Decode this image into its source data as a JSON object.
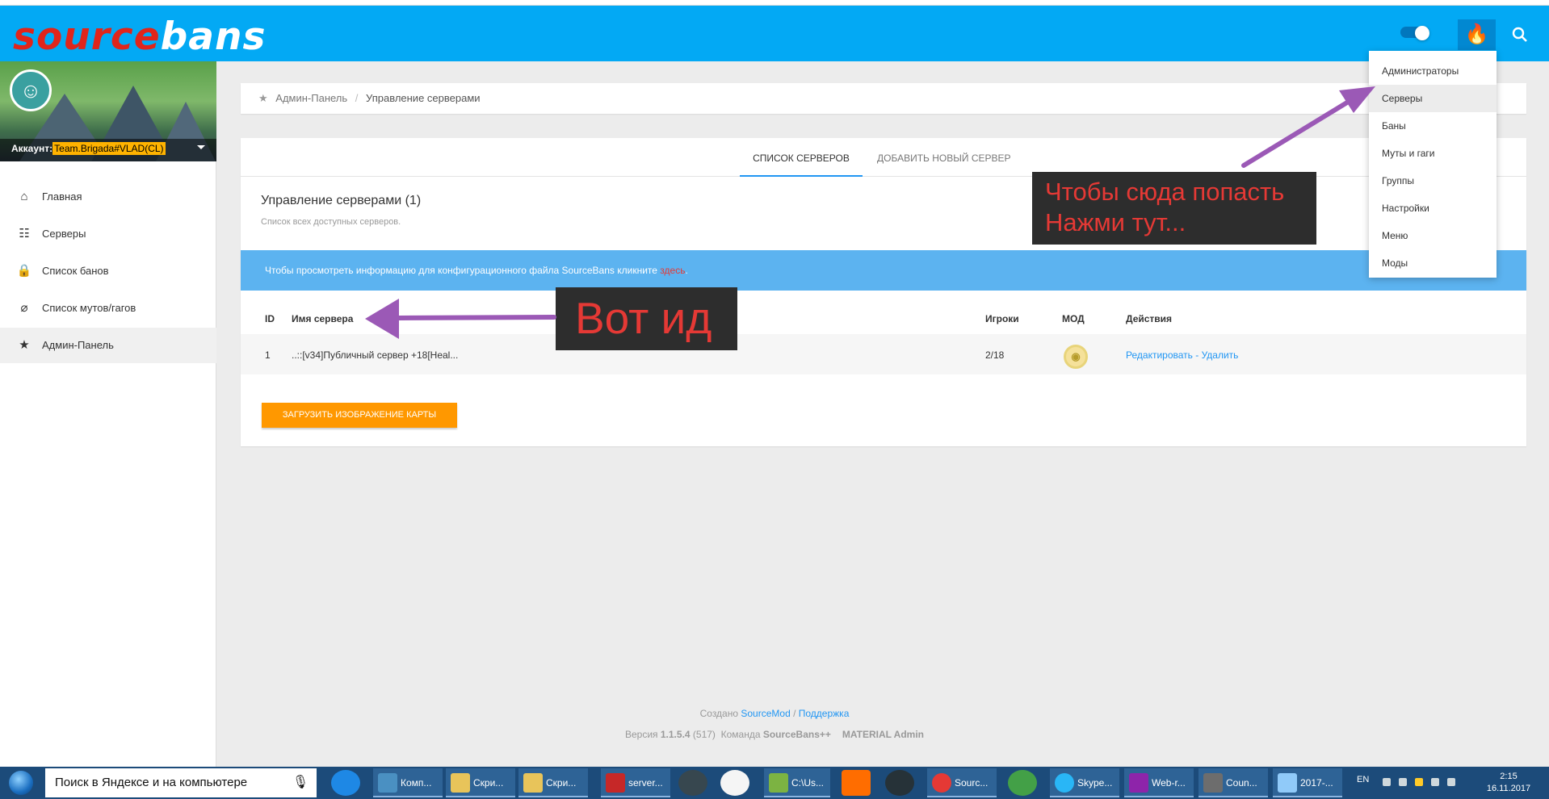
{
  "header": {
    "logo_part1": "source",
    "logo_part2": "bans",
    "search_icon": "search-icon",
    "fire_icon": "fire-icon"
  },
  "sidebar": {
    "account_label": "Аккаунт:",
    "account_name": "Team.Brigada#VLAD(CL)",
    "items": [
      {
        "label": "Главная",
        "icon": "home-icon"
      },
      {
        "label": "Серверы",
        "icon": "sliders-icon"
      },
      {
        "label": "Список банов",
        "icon": "lock-icon"
      },
      {
        "label": "Список мутов/гагов",
        "icon": "mic-off-icon"
      },
      {
        "label": "Админ-Панель",
        "icon": "star-icon"
      }
    ]
  },
  "breadcrumb": {
    "home": "Админ-Панель",
    "separator": "/",
    "current": "Управление серверами"
  },
  "tabs": [
    "Список серверов",
    "Добавить новый сервер"
  ],
  "card": {
    "title": "Управление серверами (1)",
    "subtitle": "Список всех доступных серверов."
  },
  "info": {
    "text": "Чтобы просмотреть информацию для конфигурационного файла SourceBans кликните ",
    "link": "здесь",
    "suffix": "."
  },
  "table": {
    "headers": [
      "ID",
      "Имя сервера",
      "Игроки",
      "МОД",
      "Действия"
    ],
    "rows": [
      {
        "id": "1",
        "name": "..::[v34]Публичный сервер +18[Heal...",
        "players": "2/18",
        "mod_icon": "csgo-mod-icon",
        "edit": "Редактировать",
        "dash": " - ",
        "delete": "Удалить"
      }
    ]
  },
  "upload_button": "Загрузить изображение карты",
  "dropdown": [
    "Администраторы",
    "Серверы",
    "Баны",
    "Муты и гаги",
    "Группы",
    "Настройки",
    "Меню",
    "Моды"
  ],
  "callouts": {
    "top_line1": "Чтобы сюда попасть",
    "top_line2": "Нажми тут...",
    "id": "Вот ид"
  },
  "footer": {
    "created": "Создано ",
    "sourcemod": "SourceMod",
    "slash": " / ",
    "support": "Поддержка",
    "version_label": "Версия ",
    "version": "1.1.5.4",
    "build": " (517)",
    "team_label": "  Команда ",
    "team": "SourceBans++",
    "theme": "MATERIAL Admin"
  },
  "taskbar": {
    "search_placeholder": "Поиск в Яндексе и на компьютере",
    "items": [
      "Комп...",
      "Скри...",
      "Скри...",
      "server...",
      "C:\\Us...",
      "Sourc...",
      "Skype...",
      "Web-r...",
      "Coun...",
      "2017-..."
    ],
    "lang": "EN",
    "time": "2:15",
    "date": "16.11.2017"
  },
  "colors": {
    "header": "#03a9f4",
    "accent": "#2196f3",
    "info_banner": "#5cb3f0",
    "upload_button": "#ff9800",
    "callout_text": "#e53935",
    "arrow": "#9b59b6"
  }
}
